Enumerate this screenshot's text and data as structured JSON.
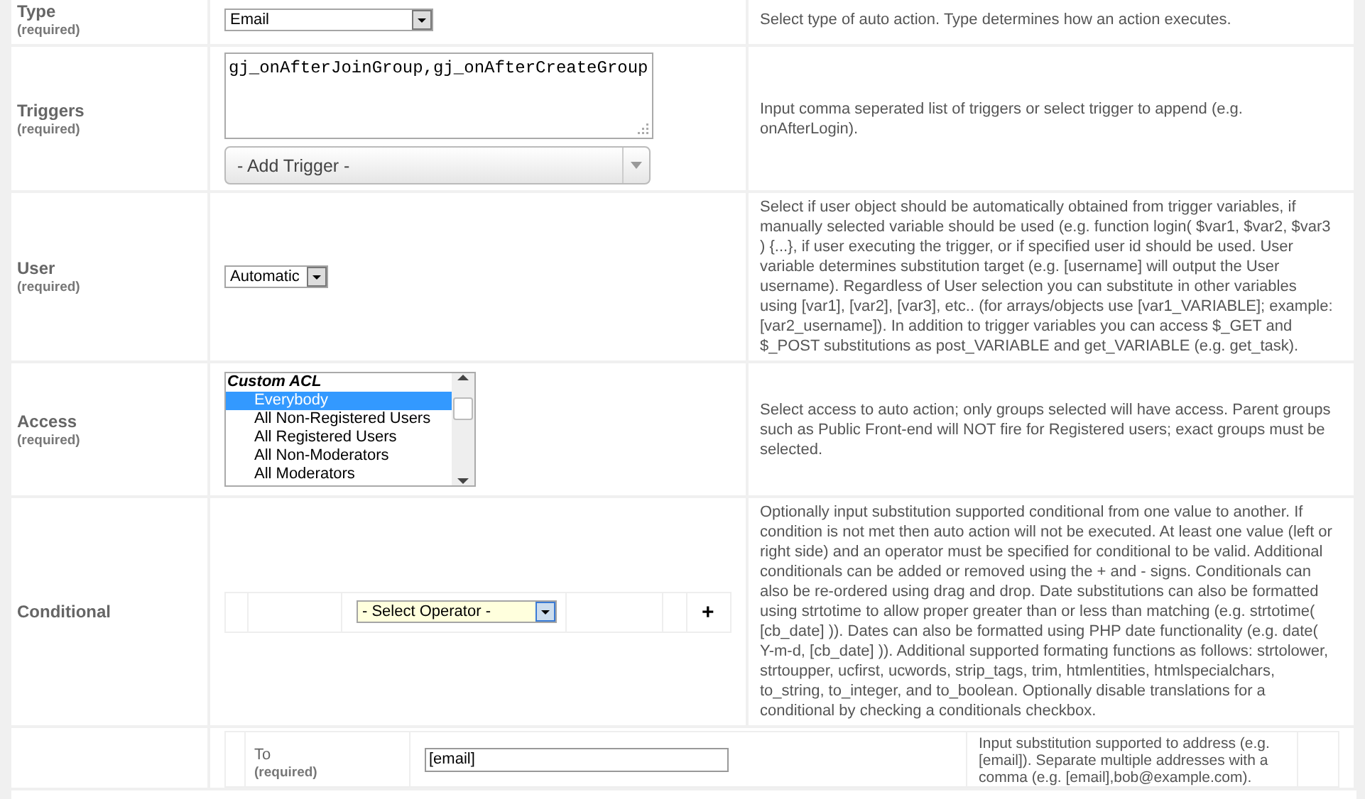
{
  "rows": [
    {
      "label": "Type",
      "note": "(required)",
      "kind": "select",
      "value": "Email",
      "description": "Select type of auto action. Type determines how an action executes."
    },
    {
      "label": "Triggers",
      "note": "(required)",
      "kind": "triggers",
      "value": "gj_onAfterJoinGroup,gj_onAfterCreateGroup",
      "add_label": "- Add Trigger -",
      "description": "Input comma seperated list of triggers or select trigger to append (e.g. onAfterLogin)."
    },
    {
      "label": "User",
      "note": "(required)",
      "kind": "select",
      "value": "Automatic",
      "description": "Select if user object should be automatically obtained from trigger variables, if manually selected variable should be used (e.g. function login( $var1, $var2, $var3 ) {...}, if user executing the trigger, or if specified user id should be used. User variable determines substitution target (e.g. [username] will output the User username). Regardless of User selection you can substitute in other variables using [var1], [var2], [var3], etc.. (for arrays/objects use [var1_VARIABLE]; example: [var2_username]). In addition to trigger variables you can access $_GET and $_POST substitutions as post_VARIABLE and get_VARIABLE (e.g. get_task)."
    },
    {
      "label": "Access",
      "note": "(required)",
      "kind": "listbox",
      "group": "Custom ACL",
      "options": [
        {
          "label": "Everybody",
          "selected": true
        },
        {
          "label": "All Non-Registered Users",
          "selected": false
        },
        {
          "label": "All Registered Users",
          "selected": false
        },
        {
          "label": "All Non-Moderators",
          "selected": false
        },
        {
          "label": "All Moderators",
          "selected": false
        }
      ],
      "description": "Select access to auto action; only groups selected will have access. Parent groups such as Public Front-end will NOT fire for Registered users; exact groups must be selected."
    },
    {
      "label": "Conditional",
      "kind": "conditional",
      "operator": "- Select Operator -",
      "add": "+",
      "description": "Optionally input substitution supported conditional from one value to another. If condition is not met then auto action will not be executed. At least one value (left or right side) and an operator must be specified for conditional to be valid. Additional conditionals can be added or removed using the + and - signs. Conditionals can also be re-ordered using drag and drop. Date substitutions can also be formatted using strtotime to allow proper greater than or less than matching (e.g. strtotime( [cb_date] )). Dates can also be formatted using PHP date functionality (e.g. date( Y-m-d, [cb_date] )). Additional supported formating functions as follows: strtolower, strtoupper, ucfirst, ucwords, strip_tags, trim, htmlentities, htmlspecialchars, to_string, to_integer, and to_boolean. Optionally disable translations for a conditional by checking a conditionals checkbox."
    },
    {
      "kind": "nested",
      "field": {
        "label": "To",
        "note": "(required)",
        "value": "[email]",
        "description": "Input substitution supported to address (e.g. [email]). Separate multiple addresses with a comma (e.g. [email],bob@example.com)."
      }
    }
  ]
}
